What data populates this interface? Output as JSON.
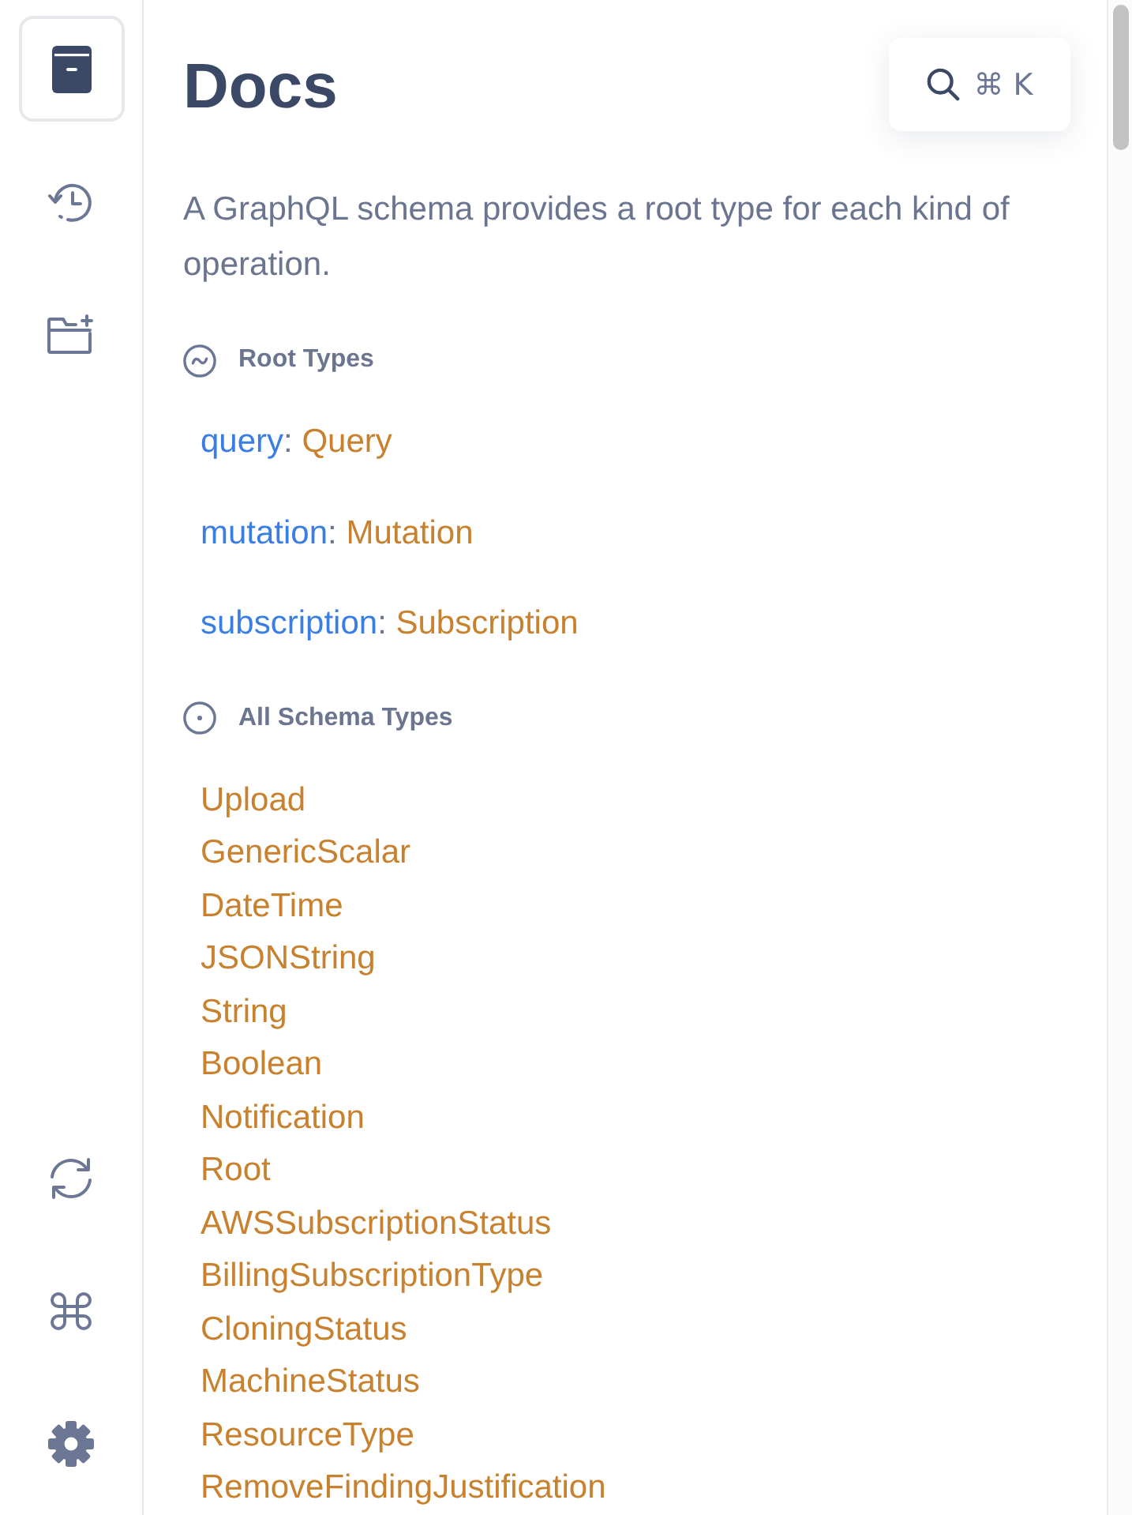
{
  "sidebar": {
    "top_items": [
      {
        "kind": "docs",
        "selected": true
      },
      {
        "kind": "history",
        "selected": false
      },
      {
        "kind": "collections",
        "selected": false
      }
    ],
    "bottom_items": [
      {
        "kind": "refresh"
      },
      {
        "kind": "shortcuts"
      },
      {
        "kind": "settings"
      }
    ]
  },
  "title": "Docs",
  "search": {
    "shortcut": "⌘ K"
  },
  "description": "A GraphQL schema provides a root type for each kind of operation.",
  "sections": [
    {
      "kind": "root_types",
      "title": "Root Types",
      "fields": [
        {
          "name": "query",
          "separator": ":",
          "type": "Query"
        },
        {
          "name": "mutation",
          "separator": ":",
          "type": "Mutation"
        },
        {
          "name": "subscription",
          "separator": ":",
          "type": "Subscription"
        }
      ]
    },
    {
      "kind": "all_types",
      "title": "All Schema Types",
      "types": [
        "Upload",
        "GenericScalar",
        "DateTime",
        "JSONString",
        "String",
        "Boolean",
        "Notification",
        "Root",
        "AWSSubscriptionStatus",
        "BillingSubscriptionType",
        "CloningStatus",
        "MachineStatus",
        "ResourceType",
        "RemoveFindingJustification"
      ]
    }
  ]
}
